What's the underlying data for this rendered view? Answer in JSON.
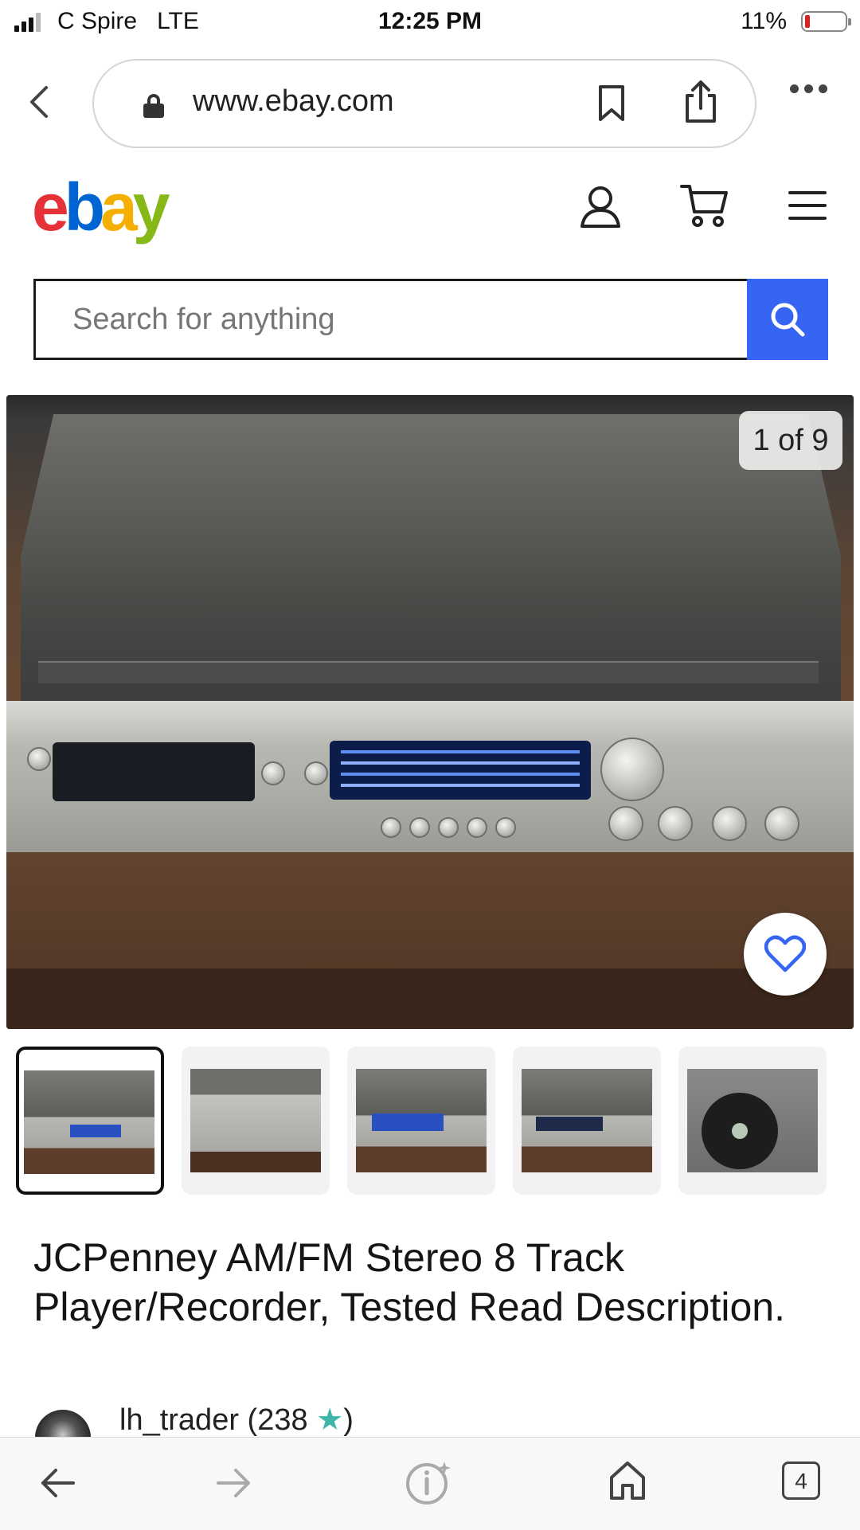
{
  "status_bar": {
    "carrier": "C Spire",
    "network": "LTE",
    "time": "12:25 PM",
    "battery": "11%"
  },
  "browser": {
    "url": "www.ebay.com",
    "open_tabs": "4"
  },
  "header": {
    "logo_letters": [
      "e",
      "b",
      "a",
      "y"
    ],
    "brand_colors": [
      "#e53238",
      "#0064d2",
      "#f5af02",
      "#86b817"
    ]
  },
  "search": {
    "placeholder": "Search for anything",
    "value": "",
    "button_color": "#3665f3"
  },
  "gallery": {
    "counter": "1 of 9",
    "thumbnail_count": 5,
    "selected_index": 0
  },
  "listing": {
    "title": "JCPenney AM/FM Stereo 8 Track Player/Recorder, Tested Read Description.",
    "seller_name": "lh_trader",
    "feedback_prefix": "(238",
    "feedback_star": "★",
    "feedback_suffix": ")"
  },
  "icons": {
    "back": "chevron-left-icon",
    "lock": "lock-icon",
    "bookmark": "bookmark-icon",
    "share": "share-icon",
    "more": "more-dots-icon",
    "account": "user-icon",
    "cart": "cart-icon",
    "menu": "menu-icon",
    "search": "search-icon",
    "watch": "heart-icon",
    "nav_back": "arrow-left-icon",
    "nav_forward": "arrow-right-icon",
    "info": "info-icon",
    "home": "home-icon",
    "tabs": "tabs-icon"
  }
}
